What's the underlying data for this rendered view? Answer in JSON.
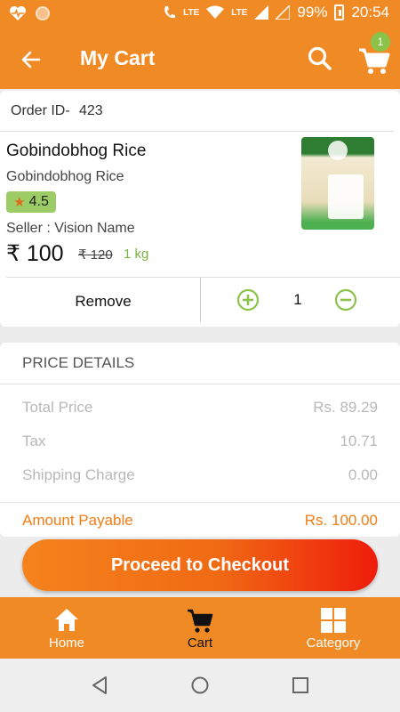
{
  "status_bar": {
    "battery": "99%",
    "time": "20:54",
    "network_a": "LTE",
    "network_b": "LTE"
  },
  "app_bar": {
    "title": "My Cart",
    "cart_badge": "1"
  },
  "order": {
    "label": "Order ID-",
    "value": "423"
  },
  "product": {
    "name": "Gobindobhog Rice",
    "subtitle": "Gobindobhog Rice",
    "rating": "4.5",
    "seller": "Seller : Vision Name",
    "price": "₹ 100",
    "mrp": "₹ 120",
    "quantity_unit": "1 kg",
    "image_icon": "rice-package-image"
  },
  "cart_actions": {
    "remove_label": "Remove",
    "count": "1"
  },
  "price_details": {
    "title": "PRICE DETAILS",
    "rows": [
      {
        "label": "Total Price",
        "value": "Rs. 89.29"
      },
      {
        "label": "Tax",
        "value": "10.71"
      },
      {
        "label": "Shipping Charge",
        "value": "0.00"
      }
    ],
    "amount_payable_label": "Amount Payable",
    "amount_payable_value": "Rs. 100.00"
  },
  "checkout_label": "Proceed to Checkout",
  "bottom_nav": [
    {
      "label": "Home",
      "icon": "home-icon"
    },
    {
      "label": "Cart",
      "icon": "cart-icon"
    },
    {
      "label": "Category",
      "icon": "grid-icon"
    }
  ],
  "colors": {
    "brand_orange": "#f08a24",
    "accent_green": "#8bc34a",
    "payable_orange": "#f07d14",
    "checkout_gradient_end": "#ef1c0b"
  }
}
